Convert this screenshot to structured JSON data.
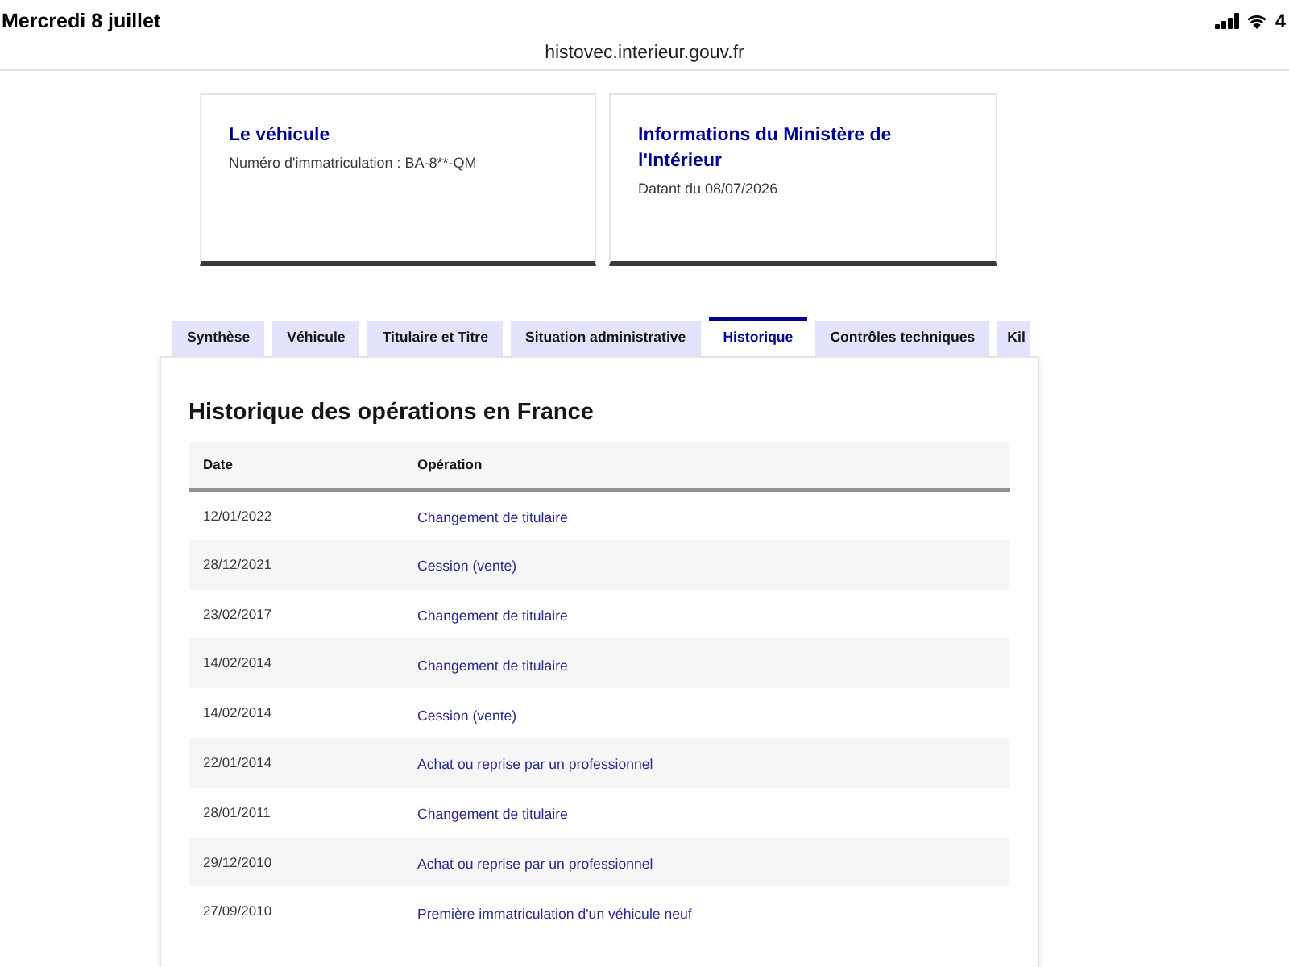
{
  "status_bar": {
    "date": "Mercredi 8 juillet",
    "battery": "4"
  },
  "address_bar": {
    "url": "histovec.interieur.gouv.fr"
  },
  "cards": [
    {
      "title": "Le véhicule",
      "subtitle": "Numéro d'immatriculation : BA-8**-QM"
    },
    {
      "title": "Informations du Ministère de l'Intérieur",
      "subtitle": "Datant du 08/07/2026"
    }
  ],
  "tabs": [
    {
      "label": "Synthèse",
      "selected": false
    },
    {
      "label": "Véhicule",
      "selected": false
    },
    {
      "label": "Titulaire et Titre",
      "selected": false
    },
    {
      "label": "Situation administrative",
      "selected": false
    },
    {
      "label": "Historique",
      "selected": true
    },
    {
      "label": "Contrôles techniques",
      "selected": false
    },
    {
      "label": "Kil",
      "selected": false
    }
  ],
  "panel": {
    "heading": "Historique des opérations en France",
    "table": {
      "columns": [
        "Date",
        "Opération"
      ],
      "rows": [
        {
          "date": "12/01/2022",
          "operation": "Changement de titulaire"
        },
        {
          "date": "28/12/2021",
          "operation": "Cession (vente)"
        },
        {
          "date": "23/02/2017",
          "operation": "Changement de titulaire"
        },
        {
          "date": "14/02/2014",
          "operation": "Changement de titulaire"
        },
        {
          "date": "14/02/2014",
          "operation": "Cession (vente)"
        },
        {
          "date": "22/01/2014",
          "operation": "Achat ou reprise par un professionnel"
        },
        {
          "date": "28/01/2011",
          "operation": "Changement de titulaire"
        },
        {
          "date": "29/12/2010",
          "operation": "Achat ou reprise par un professionnel"
        },
        {
          "date": "27/09/2010",
          "operation": "Première immatriculation d'un véhicule neuf"
        }
      ]
    }
  }
}
